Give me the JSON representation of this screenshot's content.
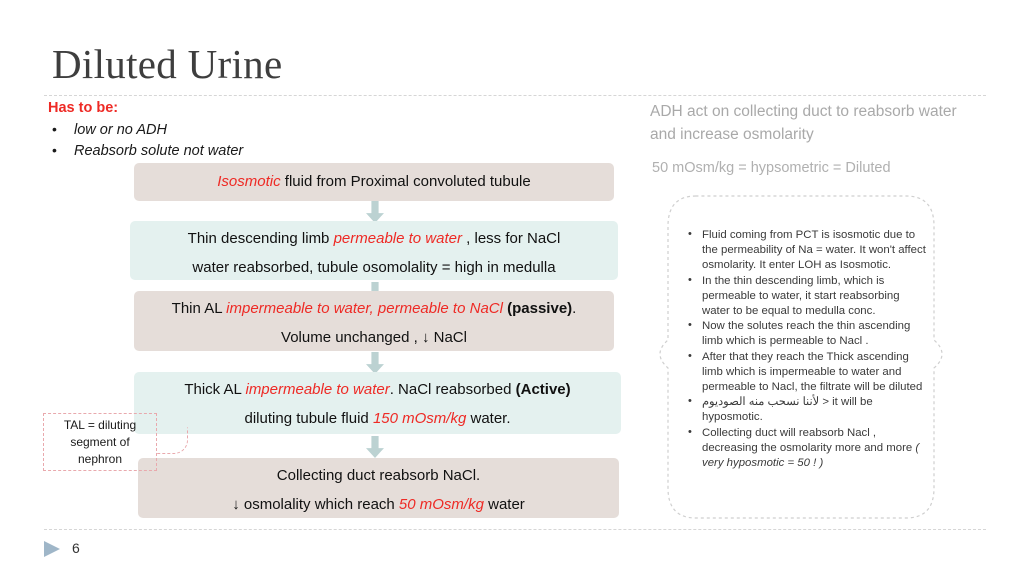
{
  "slide": {
    "title": "Diluted Urine",
    "page_number": "6",
    "accent_red": "#ee2a25",
    "box_beige": "#e5ddd9",
    "box_cyan": "#e4f1ef",
    "arrow_color": "#bcd2d2",
    "callout_border": "#e9a9ad",
    "note_text_color": "#3a3a3a",
    "header_gray": "#a9a9a9"
  },
  "requirements": {
    "heading": "Has to be:",
    "items": [
      "low or no ADH",
      "Reabsorb solute not water"
    ]
  },
  "flow": {
    "box1": {
      "emphasis": "Isosmotic",
      "rest": " fluid from Proximal convoluted tubule"
    },
    "box2": {
      "line1_a": "Thin descending limb ",
      "line1_em": "permeable to water",
      "line1_b": " , less for NaCl",
      "line2": "water reabsorbed, tubule osomolality = high in medulla"
    },
    "box3": {
      "line1_a": "Thin AL ",
      "line1_em": "impermeable to water, permeable to NaCl",
      "line1_bold": " (passive)",
      "line1_b": ".",
      "line2": "Volume unchanged ,  ↓ NaCl"
    },
    "box4": {
      "line1_a": "Thick AL ",
      "line1_em": "impermeable to water",
      "line1_b": ". NaCl reabsorbed ",
      "line1_bold": "(Active)",
      "line2_a": "diluting tubule fluid ",
      "line2_em": "150 mOsm/kg",
      "line2_b": " water."
    },
    "box5": {
      "line1": "Collecting duct reabsorb NaCl.",
      "line2_a": "↓ osmolality which reach ",
      "line2_em": "50 mOsm/kg",
      "line2_b": " water"
    }
  },
  "tal_callout": {
    "line1": "TAL =  diluting",
    "line2": "segment of",
    "line3": "nephron"
  },
  "right_panel": {
    "heading": "ADH act on collecting duct to reabsorb water and increase osmolarity",
    "subheading": "50 mOsm/kg  = hypsometric = Diluted",
    "notes": [
      "Fluid coming from PCT is isosmotic due to the permeability of Na = water. It won't affect osmolarity. It enter LOH  as Isosmotic.",
      "In the thin descending limb, which is permeable to water, it start reabsorbing water to be equal to medulla conc.",
      "Now the solutes reach the thin ascending limb  which is permeable to Nacl .",
      "After that they reach the Thick ascending limb  which is impermeable to water and permeable to Nacl,  the filtrate will be diluted",
      "لأننا نسحب منه الصوديوم",
      "Collecting duct will reabsorb Nacl , decreasing the osmolarity  more and more"
    ],
    "note5_suffix": " > it will be hyposmotic.",
    "note6_suffix": " ( very hyposmotic = 50 ! )"
  }
}
